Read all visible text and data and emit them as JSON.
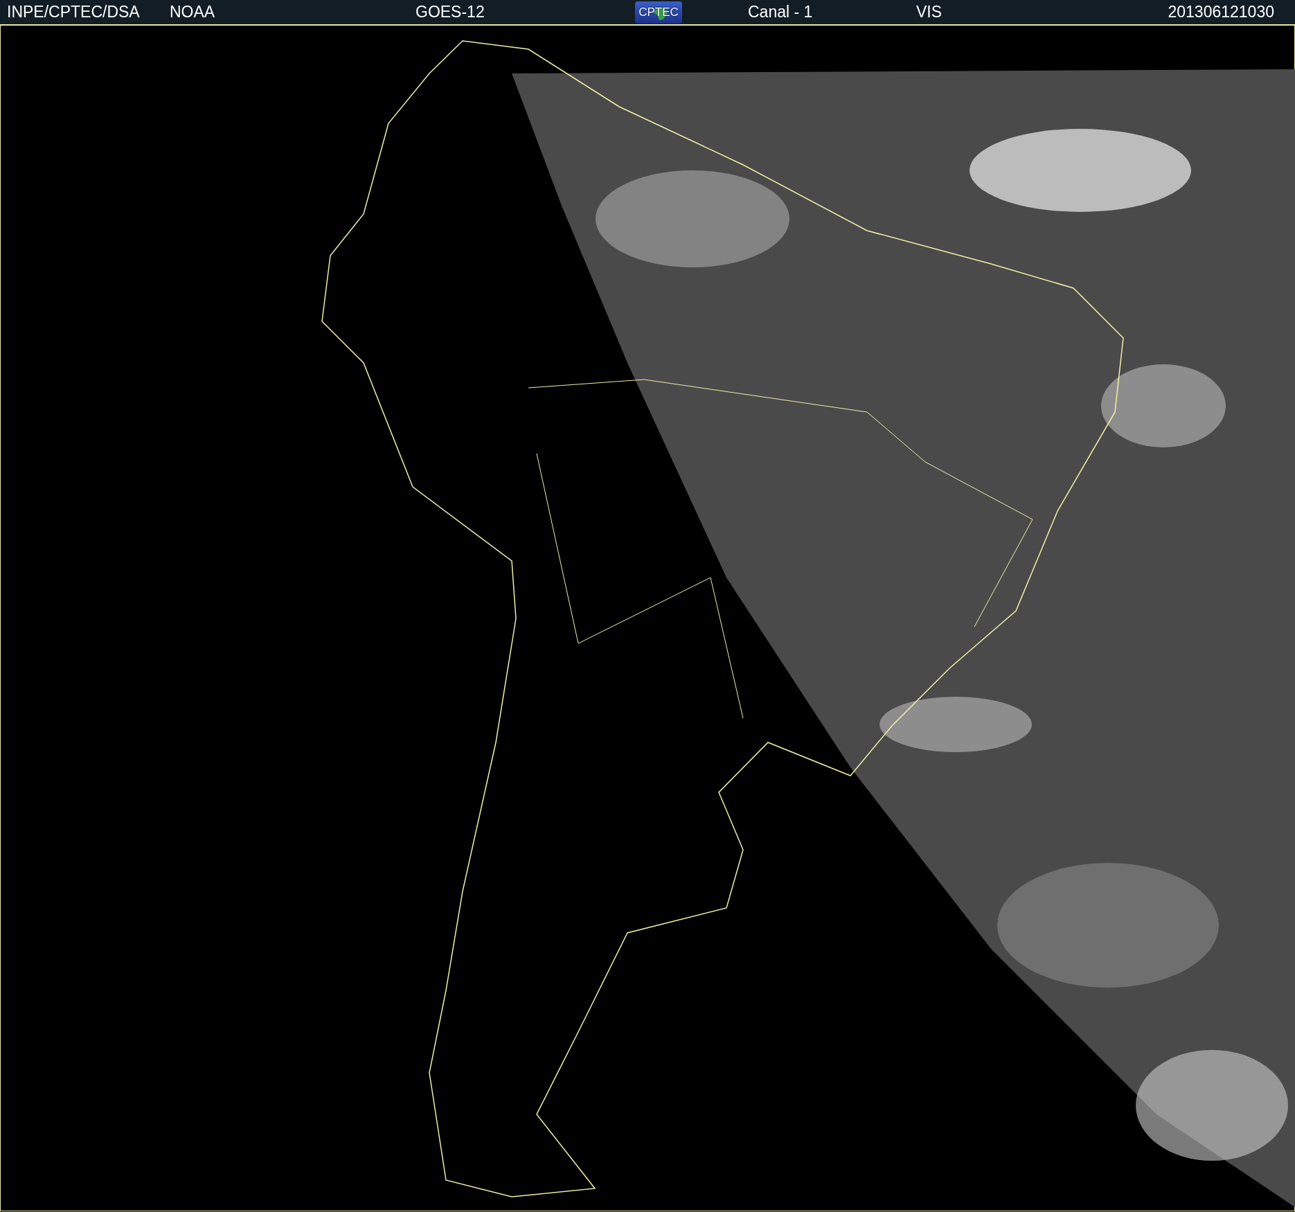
{
  "header": {
    "agency": "INPE/CPTEC/DSA",
    "source": "NOAA",
    "satellite": "GOES-12",
    "logo_text": "CPTEC",
    "channel": "Canal - 1",
    "band": "VIS",
    "timestamp": "201306121030"
  }
}
